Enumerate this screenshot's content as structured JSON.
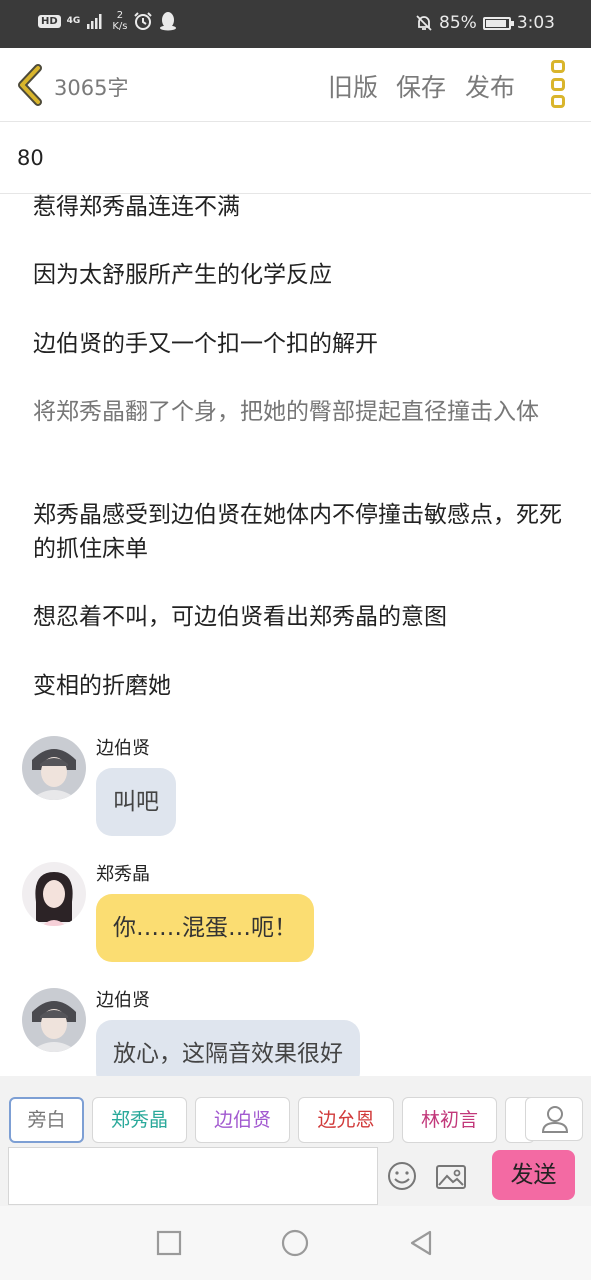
{
  "status_bar": {
    "hd": "HD",
    "network": "4G",
    "speed_value": "2",
    "speed_unit": "K/s",
    "battery": "85%",
    "battery_level": 0.85,
    "time": "3:03"
  },
  "header": {
    "word_count": "3065字",
    "old_version": "旧版",
    "save": "保存",
    "publish": "发布"
  },
  "title": "80",
  "paragraphs": [
    "惹得郑秀晶连连不满",
    "因为太舒服所产生的化学反应",
    "边伯贤的手又一个扣一个扣的解开",
    "将郑秀晶翻了个身，把她的臀部提起直径撞击入体",
    "郑秀晶感受到边伯贤在她体内不停撞击敏感点，死死的抓住床单",
    "想忍着不叫，可边伯贤看出郑秀晶的意图",
    "变相的折磨她"
  ],
  "messages": [
    {
      "name": "边伯贤",
      "text": "叫吧"
    },
    {
      "name": "郑秀晶",
      "text": "你……混蛋…呃！"
    },
    {
      "name": "边伯贤",
      "text": "放心，这隔音效果很好"
    }
  ],
  "characters": [
    {
      "label": "旁白",
      "color": "#777777"
    },
    {
      "label": "郑秀晶",
      "color": "#2aa99a"
    },
    {
      "label": "边伯贤",
      "color": "#a25ad0"
    },
    {
      "label": "边允恩",
      "color": "#d13b3b"
    },
    {
      "label": "林初言",
      "color": "#c2387a"
    }
  ],
  "input": {
    "placeholder": "",
    "send": "发送"
  },
  "colors": {
    "accent_gold": "#d9b52c",
    "send_button": "#f36aa3",
    "bubble_gray": "#dfe5ee",
    "bubble_yellow": "#fbdd72"
  },
  "icons": {
    "back": "chevron-left-icon",
    "more": "more-squares-icon",
    "emoji": "smiley-icon",
    "image": "image-icon",
    "person": "person-icon",
    "nav_recent": "square-icon",
    "nav_home": "circle-icon",
    "nav_back": "triangle-back-icon"
  }
}
